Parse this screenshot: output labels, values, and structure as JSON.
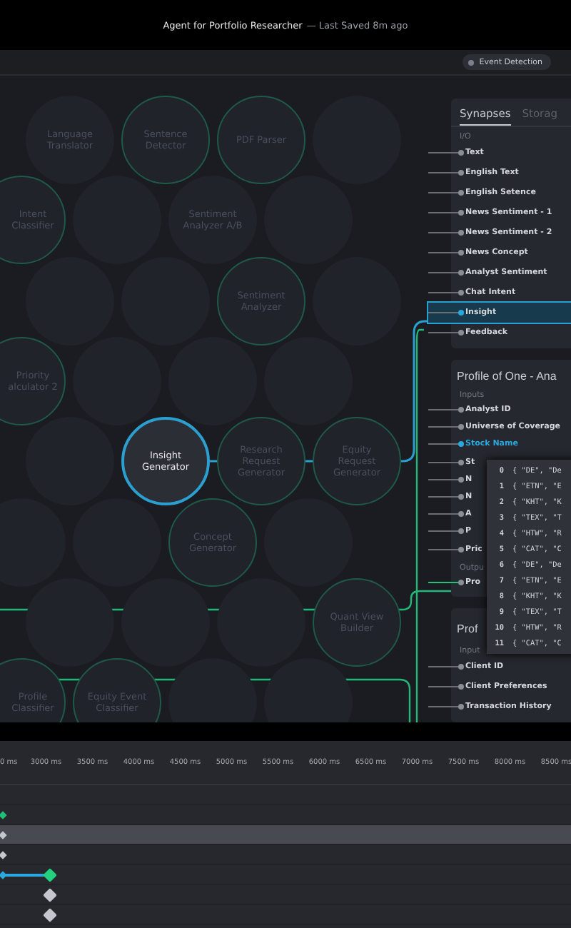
{
  "window": {
    "title": "Agent for Portfolio Researcher",
    "saved": "— Last Saved 8m ago"
  },
  "toolbar": {
    "chips": [
      {
        "label": "Event Detection"
      }
    ]
  },
  "canvas": {
    "nodes": [
      {
        "label": "Language Translator",
        "linked": false,
        "selected": false
      },
      {
        "label": "Sentence Detector",
        "linked": true,
        "selected": false
      },
      {
        "label": "PDF Parser",
        "linked": true,
        "selected": false
      },
      {
        "linked": false,
        "selected": false
      },
      {
        "label": "Intent Classifier",
        "linked": true,
        "selected": false
      },
      {
        "linked": false,
        "selected": false
      },
      {
        "label": "Sentiment Analyzer A/B",
        "linked": false,
        "selected": false
      },
      {
        "linked": false,
        "selected": false
      },
      {
        "linked": false,
        "selected": false
      },
      {
        "linked": false,
        "selected": false
      },
      {
        "label": "Sentiment Analyzer",
        "linked": true,
        "selected": false
      },
      {
        "linked": false,
        "selected": false
      },
      {
        "label": "Priority\nalculator 2",
        "linked": true,
        "selected": false
      },
      {
        "linked": false,
        "selected": false
      },
      {
        "linked": false,
        "selected": false
      },
      {
        "linked": false,
        "selected": false
      },
      {
        "linked": false,
        "selected": false
      },
      {
        "label": "Insight Generator",
        "selected": true
      },
      {
        "label": "Research Request Generator",
        "linked": true,
        "selected": false
      },
      {
        "label": "Equity Request Generator",
        "linked": true,
        "selected": false
      },
      {
        "linked": false,
        "selected": false
      },
      {
        "linked": false,
        "selected": false
      },
      {
        "label": "Concept Generator",
        "linked": true,
        "selected": false
      },
      {
        "linked": false,
        "selected": false
      },
      {
        "linked": false,
        "selected": false
      },
      {
        "linked": false,
        "selected": false
      },
      {
        "linked": false,
        "selected": false
      },
      {
        "label": "Quant View Builder",
        "linked": true,
        "selected": false
      },
      {
        "label": "Profile Classifier",
        "linked": true,
        "selected": false
      },
      {
        "label": "Equity Event Classifier",
        "linked": true,
        "selected": false
      },
      {
        "linked": false,
        "selected": false
      },
      {
        "linked": false,
        "selected": false
      }
    ]
  },
  "synapses": {
    "tabs": [
      {
        "label": "Synapses",
        "selected": true
      },
      {
        "label": "Storag",
        "selected": false
      }
    ],
    "section": "I/O",
    "ports": [
      {
        "label": "Text",
        "selected": false
      },
      {
        "label": "English Text",
        "selected": false
      },
      {
        "label": "English Setence",
        "selected": false
      },
      {
        "label": "News Sentiment - 1",
        "selected": false
      },
      {
        "label": "News Sentiment - 2",
        "selected": false
      },
      {
        "label": "News Concept",
        "selected": false
      },
      {
        "label": "Analyst Sentiment",
        "selected": false
      },
      {
        "label": "Chat Intent",
        "selected": false
      },
      {
        "label": "Insight",
        "selected": true
      },
      {
        "label": "Feedback",
        "selected": false
      }
    ]
  },
  "profile_cards": [
    {
      "title": "Profile of One - Ana",
      "sections": [
        {
          "label": "Inputs",
          "ports": [
            {
              "label": "Analyst ID",
              "selected": false
            },
            {
              "label": "Universe of Coverage",
              "selected": false
            },
            {
              "label": "Stock Name",
              "selected": true
            },
            {
              "label": "St",
              "selected": false
            },
            {
              "label": "N",
              "selected": false
            },
            {
              "label": "N",
              "selected": false
            },
            {
              "label": "A",
              "selected": false
            },
            {
              "label": "P",
              "selected": false
            },
            {
              "label": "Pric",
              "selected": false
            }
          ]
        },
        {
          "label": "Outpu",
          "ports": [
            {
              "label": "Pro",
              "selected": false
            }
          ]
        }
      ]
    },
    {
      "title": "Prof",
      "sections": [
        {
          "label": "Input",
          "ports": [
            {
              "label": "Client ID",
              "selected": false
            },
            {
              "label": "Client Preferences",
              "selected": false
            },
            {
              "label": "Transaction History",
              "selected": false
            }
          ]
        }
      ]
    }
  ],
  "value_popup": {
    "rows": [
      {
        "index": "0",
        "value": "{ \"DE\", \"De"
      },
      {
        "index": "1",
        "value": "{ \"ETN\", \"E"
      },
      {
        "index": "2",
        "value": "{ \"KHT\", \"K"
      },
      {
        "index": "3",
        "value": "{ \"TEX\", \"T"
      },
      {
        "index": "4",
        "value": "{ \"HTW\", \"R"
      },
      {
        "index": "5",
        "value": "{ \"CAT\", \"C"
      },
      {
        "index": "6",
        "value": "{ \"DE\", \"De"
      },
      {
        "index": "7",
        "value": "{ \"ETN\", \"E"
      },
      {
        "index": "8",
        "value": "{ \"KHT\", \"K"
      },
      {
        "index": "9",
        "value": "{ \"TEX\", \"T"
      },
      {
        "index": "10",
        "value": "{ \"HTW\", \"R"
      },
      {
        "index": "11",
        "value": "{ \"CAT\", \"C"
      }
    ]
  },
  "timeline": {
    "ticks": [
      "0 ms",
      "3000 ms",
      "3500 ms",
      "4000 ms",
      "4500 ms",
      "5000 ms",
      "5500 ms",
      "6000 ms",
      "6500 ms",
      "7000 ms",
      "7500 ms",
      "8000 ms",
      "8500 ms"
    ],
    "tracks": [
      {
        "selected": false
      },
      {
        "selected": false,
        "start_key": {
          "kind": "small",
          "color": "#1fbf7a"
        }
      },
      {
        "selected": true,
        "start_key": {
          "kind": "small",
          "color": "#c4c7ce"
        }
      },
      {
        "selected": false,
        "start_key": {
          "kind": "small",
          "color": "#c4c7ce"
        }
      },
      {
        "selected": false,
        "linked": true,
        "start_key": {
          "kind": "small",
          "color": "#2aa8e0"
        },
        "key_3000ms": {
          "kind": "large",
          "color": "#22d07e"
        }
      },
      {
        "selected": false,
        "key_3000ms": {
          "kind": "large",
          "color": "#c4c7ce"
        }
      },
      {
        "selected": false,
        "key_3000ms": {
          "kind": "large",
          "color": "#c4c7ce"
        }
      }
    ]
  }
}
